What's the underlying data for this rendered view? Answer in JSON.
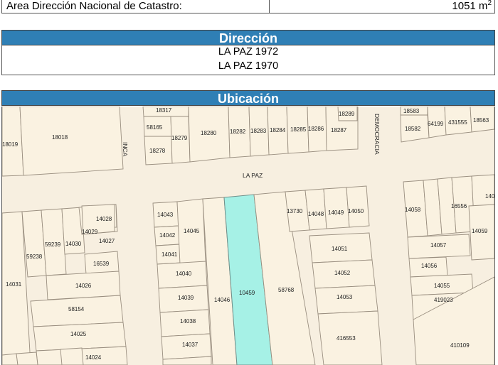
{
  "area": {
    "label": "Area Dirección Nacional de Catastro:",
    "value": "1051 m",
    "unit_sup": "2"
  },
  "direccion": {
    "title": "Dirección",
    "lines": [
      "LA PAZ 1972",
      "LA PAZ 1970"
    ]
  },
  "ubicacion": {
    "title": "Ubicación"
  },
  "map": {
    "streets": {
      "inca": "INCA",
      "la_paz": "LA PAZ",
      "democracia": "DEMOCRACIA"
    },
    "parcels": {
      "p18317": "18317",
      "p18165": "58165",
      "p18279": "18279",
      "p18278": "18278",
      "p18280": "18280",
      "p18282": "18282",
      "p18283": "18283",
      "p18284": "18284",
      "p18285": "18285",
      "p18286": "18286",
      "p18287": "18287",
      "p18289": "18289",
      "p18019": "18019",
      "p18018": "18018",
      "p18583": "18583",
      "p18582": "18582",
      "p64199": "64199",
      "p431555": "431555",
      "p18563": "18563",
      "p14028": "14028",
      "p14029": "14029",
      "p14027": "14027",
      "p59239": "59239",
      "p14030": "14030",
      "p59238": "59238",
      "p16539": "16539",
      "p14031": "14031",
      "p14026": "14026",
      "p58154": "58154",
      "p14025": "14025",
      "p14024": "14024",
      "p14043": "14043",
      "p14045": "14045",
      "p14042": "14042",
      "p14041": "14041",
      "p14040": "14040",
      "p14039": "14039",
      "p14038": "14038",
      "p14037": "14037",
      "p14046": "14046",
      "p10459": "10459",
      "p58768": "58768",
      "p13730": "13730",
      "p14048": "14048",
      "p14049": "14049",
      "p14050": "14050",
      "p14051": "14051",
      "p14052": "14052",
      "p14053": "14053",
      "p416553": "416553",
      "p14058": "14058",
      "p16556": "16556",
      "p140": "140",
      "p14059": "14059",
      "p14057": "14057",
      "p14056": "14056",
      "p14055": "14055",
      "p419023": "419023",
      "p410109": "410109"
    }
  }
}
